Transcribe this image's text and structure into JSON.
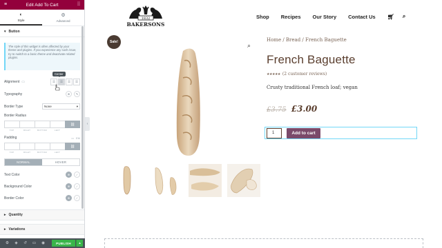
{
  "panel": {
    "header_title": "Edit Add To Cart",
    "tabs": [
      {
        "label": "Style",
        "icon": "half-circle-icon",
        "active": true
      },
      {
        "label": "Advanced",
        "icon": "gear-icon",
        "active": false
      }
    ],
    "section_button": "Button",
    "note": "The style of this widget is often affected by your theme and plugins. If you experience any such issue, try to switch to a basic theme and deactivate related plugins.",
    "alignment_label": "Alignment",
    "tooltip": "Center",
    "typography_label": "Typography",
    "border_type_label": "Border Type",
    "border_type_value": "None",
    "border_radius_label": "Border Radius",
    "padding_label": "Padding",
    "padding_unit": "EM",
    "dim_caps": [
      "TOP",
      "RIGHT",
      "BOTTOM",
      "LEFT"
    ],
    "state_tabs": [
      "NORMAL",
      "HOVER"
    ],
    "text_color_label": "Text Color",
    "background_color_label": "Background Color",
    "border_color_label": "Border Color",
    "section_quantity": "Quantity",
    "section_variations": "Variations",
    "publish_label": "PUBLISH"
  },
  "site": {
    "brand_year": "1832",
    "brand_name": "BAKERSONS",
    "nav": [
      "Shop",
      "Recipes",
      "Our Story",
      "Contact Us"
    ],
    "sale_badge": "Sale!",
    "breadcrumb": "Home / Bread / French Baguette",
    "product_title": "French Baguette",
    "rating_stars": "★★★★★",
    "reviews": "(2 customer reviews)",
    "description": "Crusty traditional French loaf; vegan",
    "old_price": "£3.75",
    "new_price": "£3.00",
    "quantity": "1",
    "add_to_cart": "Add to cart"
  },
  "colors": {
    "header_accent": "#93003c",
    "title_brown": "#5a3e2e",
    "button_purple": "#7a4a6a",
    "publish_green": "#39b54a"
  }
}
